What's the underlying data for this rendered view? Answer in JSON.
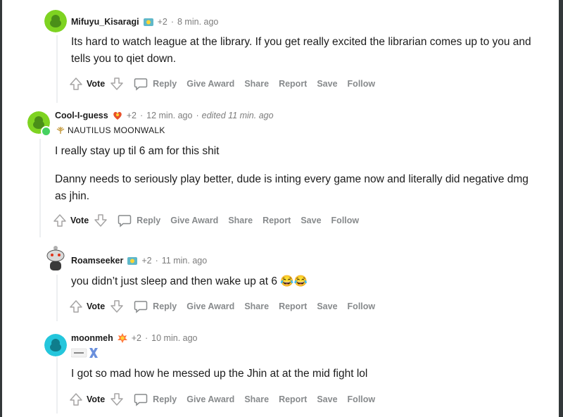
{
  "comments": [
    {
      "username": "Mifuyu_Kisaragi",
      "awards_count": "+2",
      "time": "8 min. ago",
      "edited": "",
      "body": [
        "Its hard to watch league at the library. If you get really excited the librarian comes up to you and tells you to qiet down."
      ]
    },
    {
      "username": "Cool-I-guess",
      "awards_count": "+2",
      "time": "12 min. ago",
      "edited": "edited 11 min. ago",
      "user_flair": "NAUTILUS MOONWALK",
      "body": [
        "I really stay up til 6 am for this shit",
        "Danny needs to seriously play better, dude is inting every game now and literally did negative dmg as jhin."
      ]
    },
    {
      "username": "Roamseeker",
      "awards_count": "+2",
      "time": "11 min. ago",
      "edited": "",
      "body": [
        "you didn’t just sleep and then wake up at 6 😂😂"
      ]
    },
    {
      "username": "moonmeh",
      "awards_count": "+2",
      "time": "10 min. ago",
      "edited": "",
      "body": [
        "I got so mad how he messed up the Jhin at at the mid fight lol"
      ]
    }
  ],
  "actions": {
    "vote": "Vote",
    "reply": "Reply",
    "give_award": "Give Award",
    "share": "Share",
    "report": "Report",
    "save": "Save",
    "follow": "Follow"
  },
  "colors": {
    "frame": "#33383a",
    "action_text": "#878a8c",
    "meta_text": "#7c7c7c",
    "online": "#46d160"
  },
  "icons": [
    "upvote-arrow-icon",
    "downvote-arrow-icon",
    "comment-bubble-icon",
    "award-badge-icon",
    "snoo-avatar-icon"
  ]
}
